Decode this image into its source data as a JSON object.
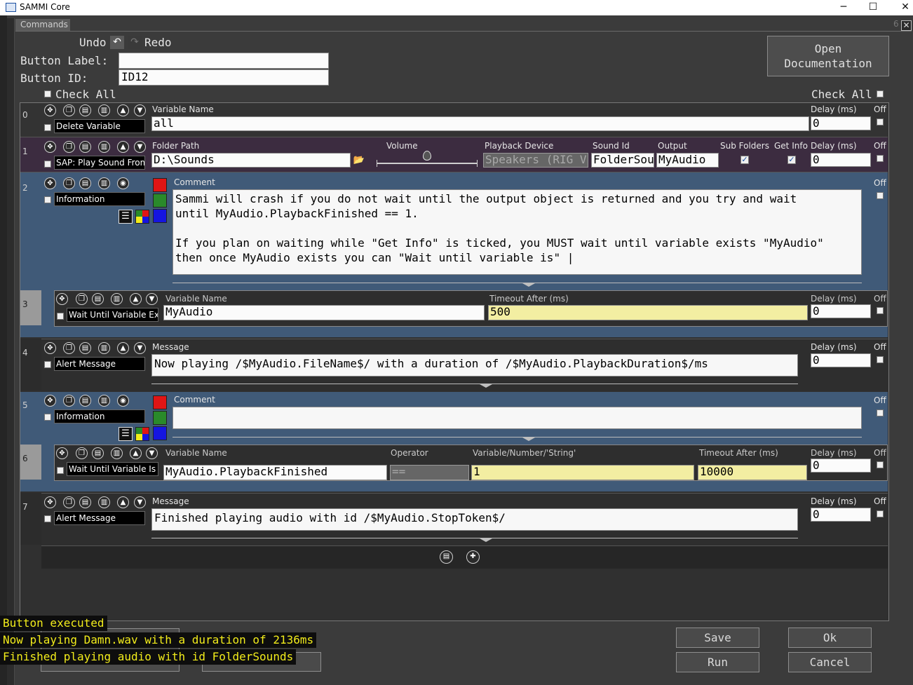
{
  "window": {
    "title": "SAMMI Core"
  },
  "tab": {
    "label": "Commands",
    "count": "6"
  },
  "header": {
    "undo_label": "Undo",
    "redo_label": "Redo",
    "button_label_caption": "Button Label:",
    "button_label_value": "",
    "button_id_caption": "Button ID:",
    "button_id_value": "ID12",
    "check_all_left": "Check All",
    "check_all_right": "Check All",
    "open_doc_line1": "Open",
    "open_doc_line2": "Documentation"
  },
  "rows": [
    {
      "num": "0",
      "command": "Delete Variable",
      "field_caption": "Variable Name",
      "field_value": "all",
      "delay_caption": "Delay (ms)",
      "delay_value": "0",
      "off_caption": "Off"
    },
    {
      "num": "1",
      "command": "SAP: Play Sound From",
      "folder_caption": "Folder Path",
      "folder_value": "D:\\Sounds",
      "volume_caption": "Volume",
      "device_caption": "Playback Device",
      "device_value": "Speakers (RIG V",
      "sound_id_caption": "Sound Id",
      "sound_id_value": "FolderSou",
      "output_caption": "Output",
      "output_value": "MyAudio",
      "sub_caption": "Sub Folders",
      "info_caption": "Get Info",
      "sub_checked": true,
      "info_checked": true,
      "delay_caption": "Delay (ms)",
      "delay_value": "0",
      "off_caption": "Off"
    },
    {
      "num": "2",
      "command": "Information",
      "field_caption": "Comment",
      "comment": "Sammi will crash if you do not wait until the output object is returned and you try and wait\nuntil MyAudio.PlaybackFinished == 1.\n\nIf you plan on waiting while \"Get Info\" is ticked, you MUST wait until variable exists \"MyAudio\"\nthen once MyAudio exists you can \"Wait until variable is\" |",
      "off_caption": "Off"
    },
    {
      "num": "3",
      "command": "Wait Until Variable Ex",
      "field_caption": "Variable Name",
      "field_value": "MyAudio",
      "timeout_caption": "Timeout After (ms)",
      "timeout_value": "500",
      "delay_caption": "Delay (ms)",
      "delay_value": "0",
      "off_caption": "Off"
    },
    {
      "num": "4",
      "command": "Alert Message",
      "field_caption": "Message",
      "field_value": "Now playing /$MyAudio.FileName$/ with a duration of /$MyAudio.PlaybackDuration$/ms",
      "delay_caption": "Delay (ms)",
      "delay_value": "0",
      "off_caption": "Off"
    },
    {
      "num": "5",
      "command": "Information",
      "field_caption": "Comment",
      "comment": "",
      "off_caption": "Off"
    },
    {
      "num": "6",
      "command": "Wait Until Variable Is",
      "field_caption": "Variable Name",
      "field_value": "MyAudio.PlaybackFinished",
      "operator_caption": "Operator",
      "operator_value": "==",
      "value_caption": "Variable/Number/'String'",
      "value_value": "1",
      "timeout_caption": "Timeout After (ms)",
      "timeout_value": "10000",
      "delay_caption": "Delay (ms)",
      "delay_value": "0",
      "off_caption": "Off"
    },
    {
      "num": "7",
      "command": "Alert Message",
      "field_caption": "Message",
      "field_value": "Finished playing audio with id /$MyAudio.StopToken$/",
      "delay_caption": "Delay (ms)",
      "delay_value": "0",
      "off_caption": "Off"
    }
  ],
  "footer": {
    "save_label": "Save",
    "ok_label": "Ok",
    "run_label": "Run",
    "cancel_label": "Cancel"
  },
  "log": [
    "Button executed",
    "Now playing Damn.wav with a duration of 2136ms",
    "Finished playing audio with id FolderSounds"
  ],
  "colors": {
    "row_purple": "#3c2c40",
    "row_blue": "#405a78",
    "swatch_red": "#e01515",
    "swatch_green": "#2a8a2a",
    "swatch_blue": "#1515e0",
    "log_text": "#f2ec1b"
  }
}
